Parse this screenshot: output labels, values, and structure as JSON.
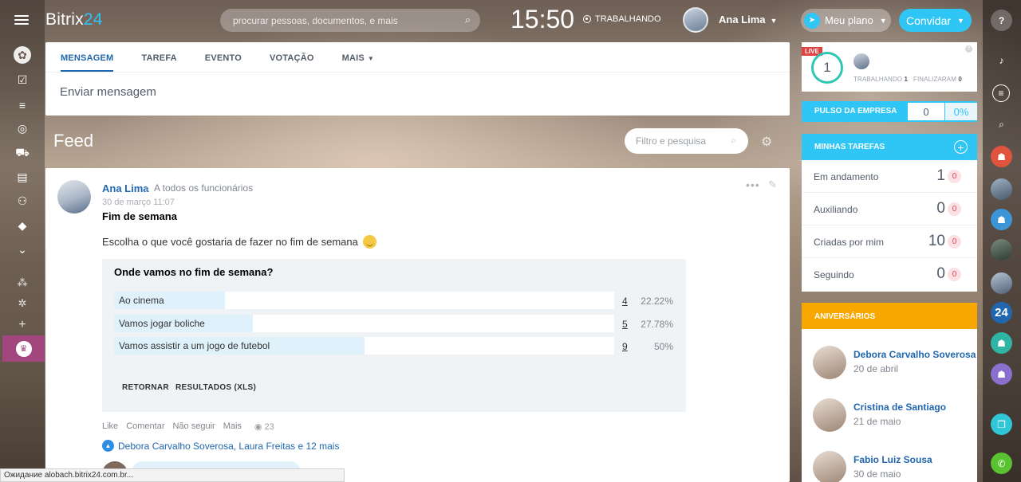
{
  "app": {
    "logo_main": "Bitrix",
    "logo_accent": "24",
    "accent_color": "#2fc6f6"
  },
  "header": {
    "search_placeholder": "procurar pessoas, documentos, e mais",
    "clock": "15:50",
    "work_status": "TRABALHANDO",
    "user_name": "Ana Lima",
    "plan_label": "Meu plano",
    "invite_label": "Convidar"
  },
  "left_menu": {
    "icons": [
      "feed-icon",
      "tasks-icon",
      "crm-icon",
      "target-icon",
      "store-icon",
      "contacts-icon",
      "robot-icon",
      "box-icon",
      "more-icon",
      "structure-icon",
      "settings-icon",
      "add-icon",
      "crown-icon"
    ]
  },
  "poster": {
    "tabs": [
      {
        "label": "MENSAGEM",
        "active": true
      },
      {
        "label": "TAREFA",
        "active": false
      },
      {
        "label": "EVENTO",
        "active": false
      },
      {
        "label": "VOTAÇÃO",
        "active": false
      },
      {
        "label": "MAIS",
        "active": false
      }
    ],
    "send_placeholder": "Enviar mensagem"
  },
  "feed": {
    "title": "Feed",
    "filter_placeholder": "Filtro e pesquisa"
  },
  "post": {
    "author": "Ana Lima",
    "recipient": "A todos os funcionários",
    "date": "30 de março 11:07",
    "title": "Fim de semana",
    "text": "Escolha o que você gostaria de fazer no fim de semana",
    "poll": {
      "question": "Onde vamos no fim de semana?",
      "options": [
        {
          "label": "Ao cinema",
          "count": "4",
          "percent": "22.22%",
          "fraction": 0.2222
        },
        {
          "label": "Vamos jogar boliche",
          "count": "5",
          "percent": "27.78%",
          "fraction": 0.2778
        },
        {
          "label": "Vamos assistir a um jogo de futebol",
          "count": "9",
          "percent": "50%",
          "fraction": 0.5
        }
      ],
      "back_label": "RETORNAR",
      "results_label": "RESULTADOS (XLS)"
    },
    "actions": {
      "like": "Like",
      "comment": "Comentar",
      "unfollow": "Não seguir",
      "more": "Mais",
      "views": "23"
    },
    "likes_text": "Debora Carvalho Soverosa, Laura Freitas e 12 mais"
  },
  "live": {
    "tag": "LIVE",
    "count": "1",
    "working_label": "TRABALHANDO",
    "working_value": "1",
    "finished_label": "FINALIZARAM",
    "finished_value": "0"
  },
  "pulse": {
    "label": "PULSO DA EMPRESA",
    "value": "0",
    "percent": "0%"
  },
  "tasks": {
    "title": "MINHAS TAREFAS",
    "rows": [
      {
        "label": "Em andamento",
        "count": "1",
        "badge": "0"
      },
      {
        "label": "Auxiliando",
        "count": "0",
        "badge": "0"
      },
      {
        "label": "Criadas por mim",
        "count": "10",
        "badge": "0"
      },
      {
        "label": "Seguindo",
        "count": "0",
        "badge": "0"
      }
    ]
  },
  "birthdays": {
    "title": "ANIVERSÁRIOS",
    "items": [
      {
        "name": "Debora Carvalho Soverosa",
        "date": "20 de abril"
      },
      {
        "name": "Cristina de Santiago",
        "date": "21 de maio"
      },
      {
        "name": "Fabio Luiz Sousa",
        "date": "30 de maio"
      }
    ]
  },
  "right_bar": {
    "icons": [
      "help-icon",
      "bell-icon",
      "chat-icon",
      "search-icon",
      "group-chat-icon",
      "photo-chat-icon",
      "people-chat-icon",
      "photo-chat-icon-2",
      "photo-chat-icon-3",
      "bitrix24-icon",
      "people-chat-icon-2",
      "people-chat-icon-3",
      "copy-icon",
      "phone-icon"
    ],
    "bitrix_label": "24"
  },
  "statusbar": {
    "text": "Ожидание alobach.bitrix24.com.br..."
  }
}
